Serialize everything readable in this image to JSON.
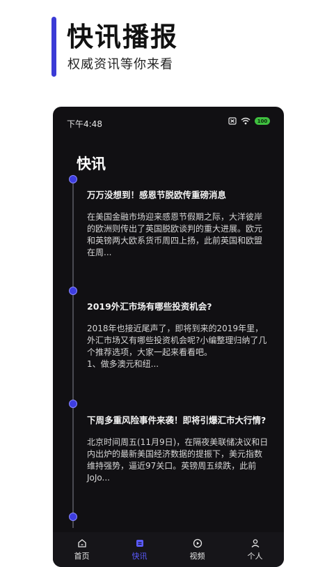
{
  "hero": {
    "title": "快讯播报",
    "subtitle": "权威资讯等你来看"
  },
  "status": {
    "time": "下午4:48",
    "battery": "100"
  },
  "section_title": "快讯",
  "news": [
    {
      "title": "万万没想到！感恩节脱欧传重磅消息",
      "summary": "在美国金融市场迎来感恩节假期之际，大洋彼岸的欧洲则传出了英国脱欧谈判的重大进展。欧元和英镑两大欧系货币周四上扬，此前英国和欧盟在周..."
    },
    {
      "title": "2019外汇市场有哪些投资机会?",
      "summary": "2018年也接近尾声了，即将到来的2019年里，外汇市场又有哪些投资机会呢?小编整理归纳了几个推荐选项，大家一起来看看吧。\n1、做多澳元和纽..."
    },
    {
      "title": "下周多重风险事件来袭！即将引爆汇市大行情?",
      "summary": "北京时间周五(11月9日)，在隔夜美联储决议和日内出炉的最新美国经济数据的提振下，美元指数维持强势，逼近97关口。英镑周五续跌，此前JoJo..."
    }
  ],
  "tabs": [
    {
      "label": "首页",
      "icon": "home-icon"
    },
    {
      "label": "快讯",
      "icon": "news-icon"
    },
    {
      "label": "视频",
      "icon": "play-icon"
    },
    {
      "label": "个人",
      "icon": "user-icon"
    }
  ],
  "colors": {
    "accent": "#3b3bd6",
    "active_tab": "#5b5bff",
    "phone_bg": "#111013"
  }
}
